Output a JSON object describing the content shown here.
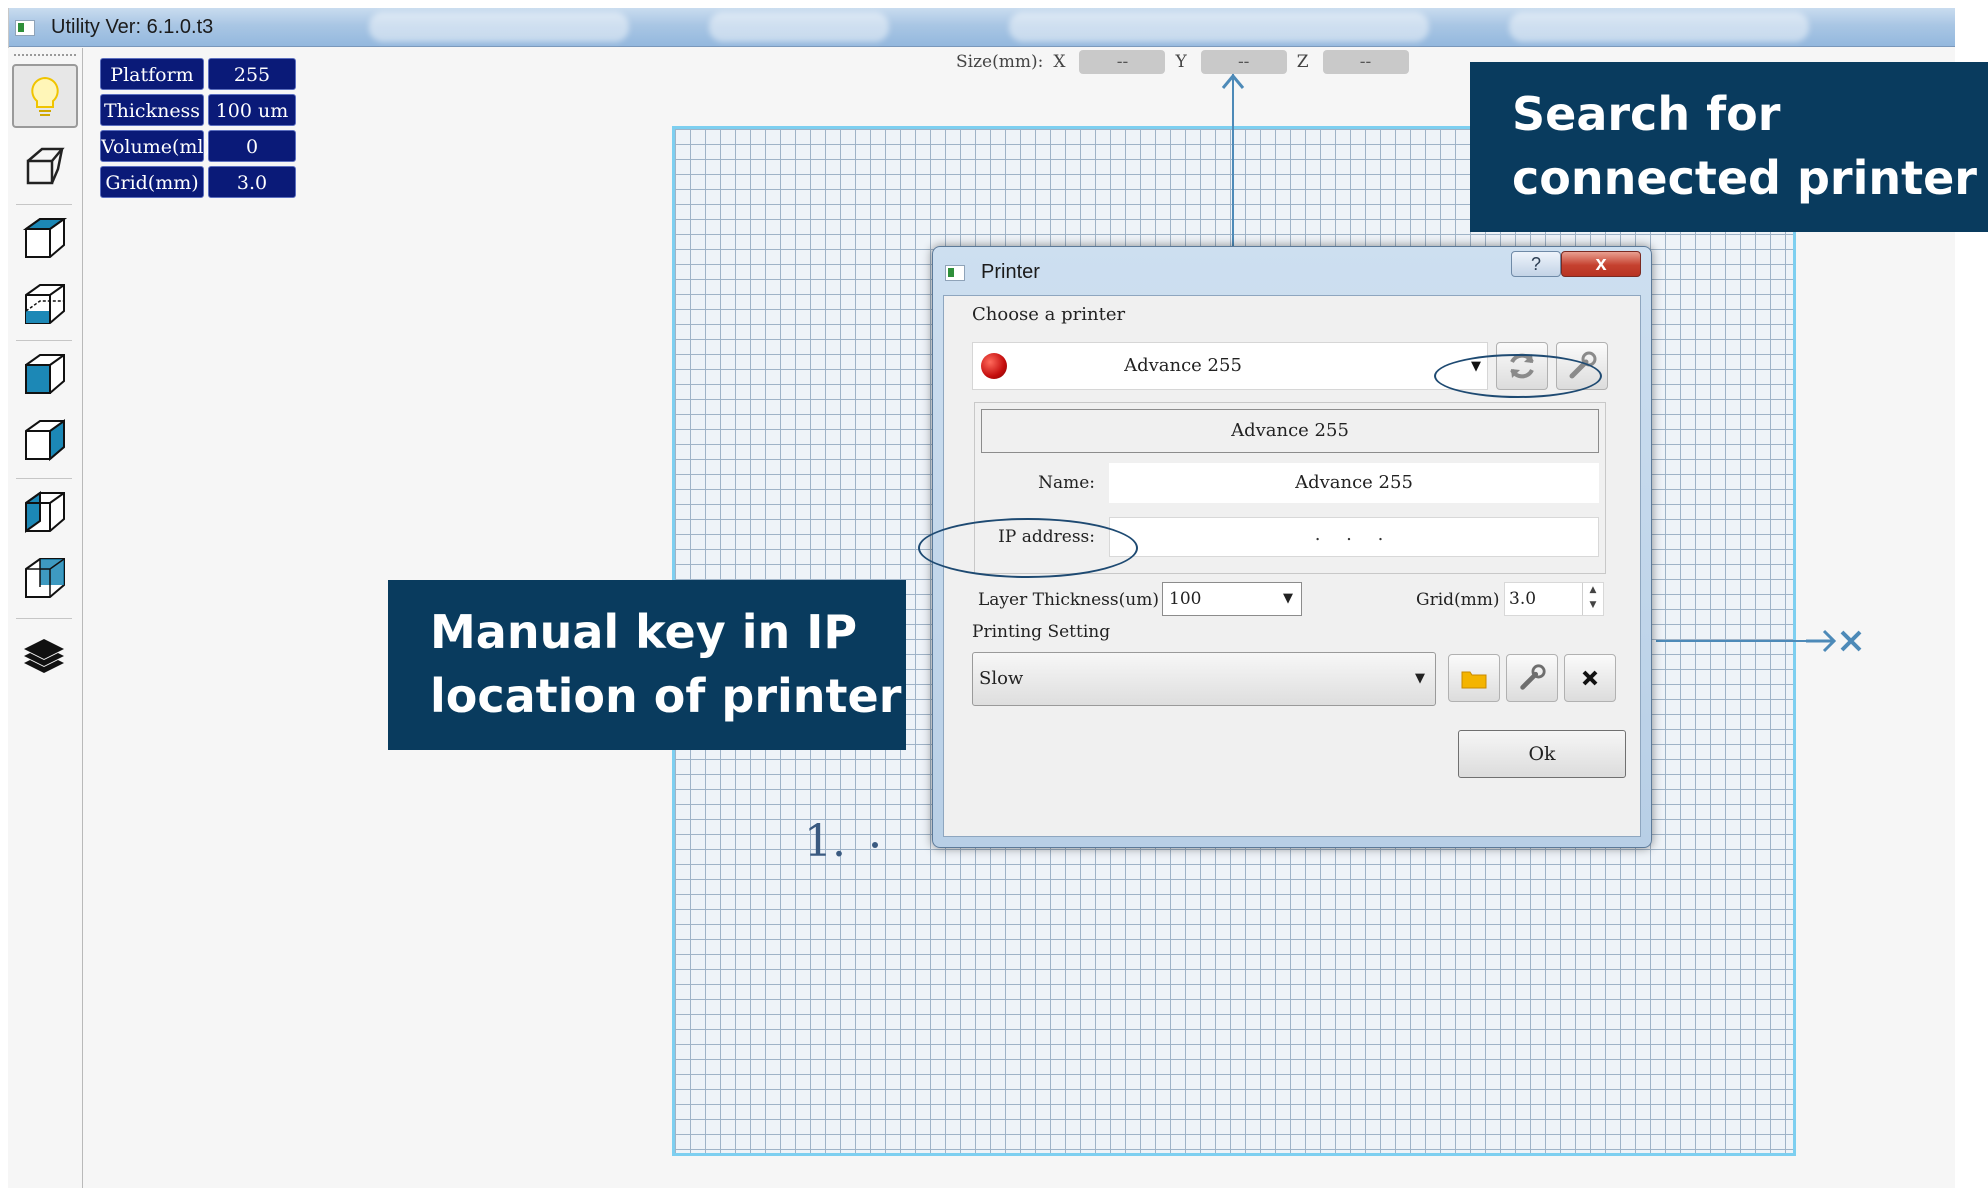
{
  "app": {
    "title": "Utility Ver: 6.1.0.t3"
  },
  "info_panel": {
    "rows": [
      {
        "label": "Platform",
        "value": "255"
      },
      {
        "label": "Thickness",
        "value": "100 um"
      },
      {
        "label": "Volume(ml)",
        "value": "0"
      },
      {
        "label": "Grid(mm)",
        "value": "3.0"
      }
    ]
  },
  "size_readout": {
    "label": "Size(mm):",
    "x_label": "X",
    "x_value": "--",
    "y_label": "Y",
    "y_value": "--",
    "z_label": "Z",
    "z_value": "--"
  },
  "toolbar": {
    "icons": [
      "lightbulb-icon",
      "perspective-plane-icon",
      "cube-view-1-icon",
      "cube-view-2-icon",
      "cube-view-3-icon",
      "cube-view-4-icon",
      "cube-view-5-icon",
      "cube-view-6-icon",
      "layers-icon"
    ]
  },
  "dialog": {
    "title": "Printer",
    "help_label": "?",
    "close_label": "x",
    "choose_label": "Choose a printer",
    "selected_printer": "Advance 255",
    "details_header": "Advance 255",
    "name_label": "Name:",
    "name_value": "Advance 255",
    "ip_label": "IP address:",
    "ip_value": ". . .",
    "layer_label": "Layer Thickness(um)",
    "layer_value": "100",
    "grid_label": "Grid(mm)",
    "grid_value": "3.0",
    "printing_label": "Printing Setting",
    "printing_value": "Slow",
    "ok_label": "Ok",
    "status_color": "#d01010"
  },
  "annotations": {
    "search_line1": "Search for",
    "search_line2": "connected printer",
    "ip_line1": "Manual key in IP",
    "ip_line2": "location of printer",
    "list_marker": "1.",
    "callout_color": "#093b5e"
  }
}
